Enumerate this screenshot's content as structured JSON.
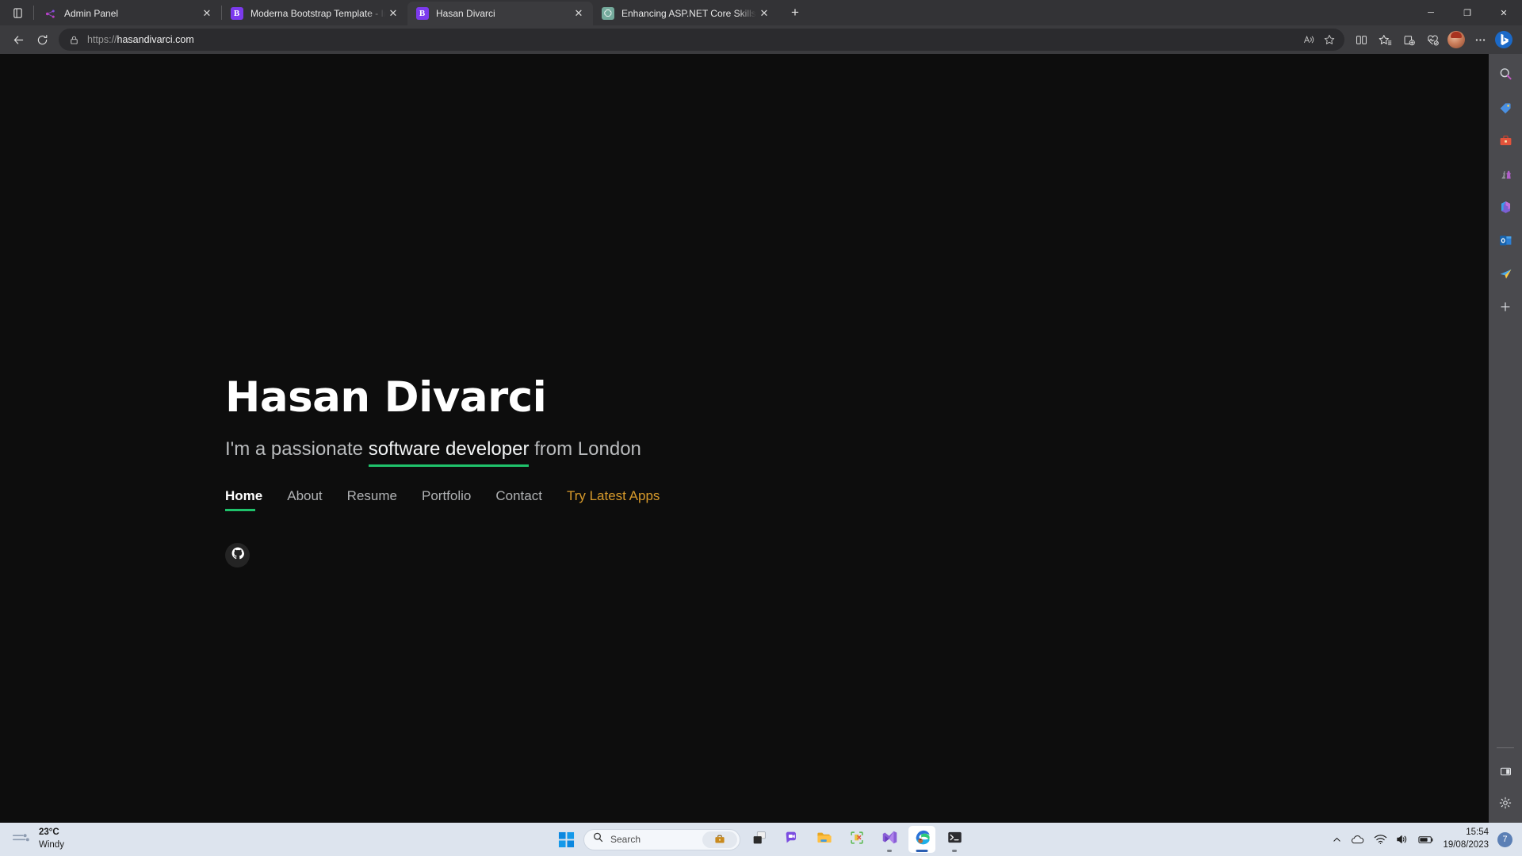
{
  "browser": {
    "tab_list_icon": "tab-list-icon",
    "tabs": [
      {
        "title": "Admin Panel",
        "favicon": "network-nodes-icon",
        "active": false
      },
      {
        "title": "Moderna Bootstrap Template - In",
        "favicon": "bootstrap-b-icon",
        "favicon_letter": "B",
        "active": false
      },
      {
        "title": "Hasan Divarci",
        "favicon": "bootstrap-b-icon",
        "favicon_letter": "B",
        "active": true
      },
      {
        "title": "Enhancing ASP.NET Core Skills",
        "favicon": "chatgpt-icon",
        "active": false
      }
    ],
    "new_tab_label": "+",
    "window_controls": {
      "minimize": "─",
      "maximize": "❐",
      "close": "✕"
    },
    "toolbar": {
      "back_label": "Back",
      "refresh_label": "Refresh",
      "url_scheme": "https://",
      "url_host": "hasandivarci.com",
      "url_full": "https://hasandivarci.com",
      "lock_icon": "lock-icon",
      "read_aloud_icon": "read-aloud-icon",
      "favorite_icon": "star-icon",
      "split_screen_icon": "split-screen-icon",
      "favorites_icon": "favorites-list-icon",
      "collections_icon": "collections-icon",
      "browser_essentials_icon": "browser-essentials-icon",
      "profile_icon": "profile-avatar",
      "settings_more_icon": "ellipsis-icon",
      "copilot_icon": "bing-copilot-icon"
    },
    "sidebar": {
      "items": [
        {
          "icon": "search-icon",
          "name": "search"
        },
        {
          "icon": "shopping-tag-icon",
          "name": "shopping"
        },
        {
          "icon": "tools-briefcase-icon",
          "name": "tools"
        },
        {
          "icon": "games-icon",
          "name": "games"
        },
        {
          "icon": "microsoft365-icon",
          "name": "microsoft-365"
        },
        {
          "icon": "outlook-icon",
          "name": "outlook"
        },
        {
          "icon": "paper-plane-icon",
          "name": "drop"
        },
        {
          "icon": "plus-icon",
          "name": "add"
        }
      ],
      "bottom": [
        {
          "icon": "customize-pane-icon",
          "name": "customize"
        },
        {
          "icon": "gear-icon",
          "name": "settings"
        }
      ]
    }
  },
  "page": {
    "name": "Hasan Divarci",
    "tagline_before": "I'm a passionate ",
    "tagline_highlight": "software developer",
    "tagline_after": " from London",
    "nav": [
      {
        "label": "Home",
        "active": true
      },
      {
        "label": "About",
        "active": false
      },
      {
        "label": "Resume",
        "active": false
      },
      {
        "label": "Portfolio",
        "active": false
      },
      {
        "label": "Contact",
        "active": false
      },
      {
        "label": "Try Latest Apps",
        "accent": true
      }
    ],
    "social": [
      {
        "icon": "github-icon",
        "name": "github"
      }
    ],
    "colors": {
      "background": "#0d0d0d",
      "accent_green": "#1fc26b",
      "accent_amber": "#d79a2b",
      "heading": "#ffffff",
      "muted_text": "#b0b2b4"
    }
  },
  "taskbar": {
    "weather": {
      "temperature": "23°C",
      "condition": "Windy",
      "icon": "windy-icon"
    },
    "start_label": "Start",
    "search": {
      "placeholder": "Search",
      "icon": "search-icon",
      "badge_icon": "briefcase-icon"
    },
    "apps": [
      {
        "name": "task-view",
        "icon": "task-view-icon",
        "running": false,
        "active": false
      },
      {
        "name": "chat",
        "icon": "chat-icon",
        "running": false,
        "active": false
      },
      {
        "name": "file-explorer",
        "icon": "folder-icon",
        "running": false,
        "active": false
      },
      {
        "name": "app-tools",
        "icon": "dev-tools-icon",
        "running": false,
        "active": false
      },
      {
        "name": "visual-studio",
        "icon": "visual-studio-icon",
        "running": true,
        "active": false
      },
      {
        "name": "microsoft-edge",
        "icon": "edge-icon",
        "running": true,
        "active": true
      },
      {
        "name": "terminal",
        "icon": "terminal-icon",
        "running": true,
        "active": false
      }
    ],
    "tray": {
      "show_hidden_icon": "chevron-up-icon",
      "onedrive_icon": "cloud-icon",
      "wifi_icon": "wifi-icon",
      "volume_icon": "speaker-icon",
      "battery_icon": "battery-icon",
      "time": "15:54",
      "date": "19/08/2023",
      "notification_count": "7"
    }
  }
}
